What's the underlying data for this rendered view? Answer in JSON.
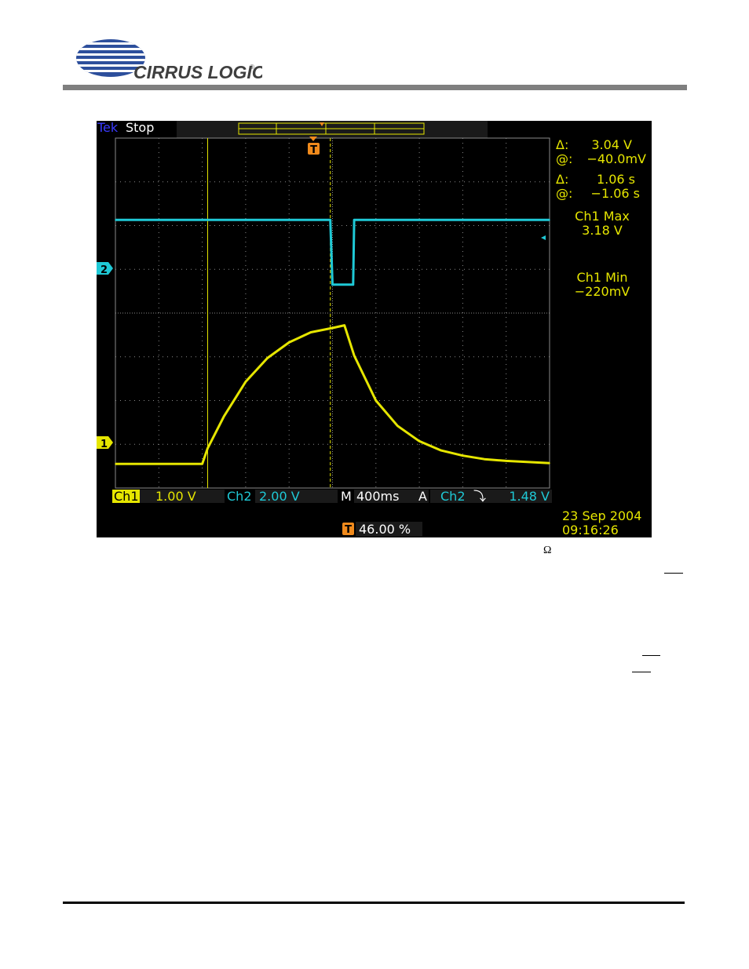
{
  "brand": {
    "name": "CIRRUS LOGIC",
    "registered": "®"
  },
  "scope": {
    "brand": "Tek",
    "status": "Stop",
    "cursor_readouts": [
      {
        "symbol": "Δ:",
        "value": "3.04 V"
      },
      {
        "symbol": "@:",
        "value": "−40.0mV"
      },
      {
        "symbol": "Δ:",
        "value": "1.06 s"
      },
      {
        "symbol": "@:",
        "value": "−1.06 s"
      }
    ],
    "measurements": [
      {
        "label": "Ch1 Max",
        "value": "3.18 V"
      },
      {
        "label": "Ch1 Min",
        "value": "−220mV"
      }
    ],
    "channel_markers": {
      "ch1": "1",
      "ch2": "2"
    },
    "trigger_marker": "T",
    "bottom": {
      "ch1_label": "Ch1",
      "ch1_scale": "1.00 V",
      "ch2_label": "Ch2",
      "ch2_scale": "2.00 V",
      "timebase_label": "M",
      "timebase": "400ms",
      "trigger_label": "A",
      "trigger_source": "Ch2",
      "trigger_slope": "⤵",
      "trigger_level": "1.48 V",
      "trigger_position": "46.00 %",
      "date": "23 Sep  2004",
      "time": "09:16:26"
    },
    "colors": {
      "ch1": "#e6e600",
      "ch2": "#1fc9d6",
      "background": "#000000",
      "grid": "#8a8a8a",
      "trigger": "#f08a1c"
    }
  },
  "chart_data": {
    "type": "line",
    "xunit": "s",
    "x_div": 0.4,
    "x_divisions": 10,
    "yunit": "div",
    "y_divisions": 8,
    "series": [
      {
        "name": "Ch1",
        "color": "#e6e600",
        "x": [
          -2.0,
          -1.2,
          -1.15,
          -1.0,
          -0.8,
          -0.6,
          -0.4,
          -0.2,
          0.0,
          0.11,
          0.2,
          0.4,
          0.6,
          0.8,
          1.0,
          1.2,
          1.4,
          1.6,
          2.0
        ],
        "y": [
          0.0,
          0.0,
          0.36,
          1.09,
          1.88,
          2.42,
          2.78,
          3.01,
          3.11,
          3.17,
          2.48,
          1.45,
          0.87,
          0.52,
          0.31,
          0.19,
          0.11,
          0.07,
          0.02
        ]
      },
      {
        "name": "Ch2",
        "color": "#1fc9d6",
        "x": [
          -2.0,
          -0.02,
          0.0,
          0.19,
          0.2,
          2.0
        ],
        "y": [
          1.48,
          1.48,
          0.0,
          0.0,
          1.48,
          1.48
        ]
      }
    ]
  },
  "page": {
    "symbol": "Ω"
  }
}
